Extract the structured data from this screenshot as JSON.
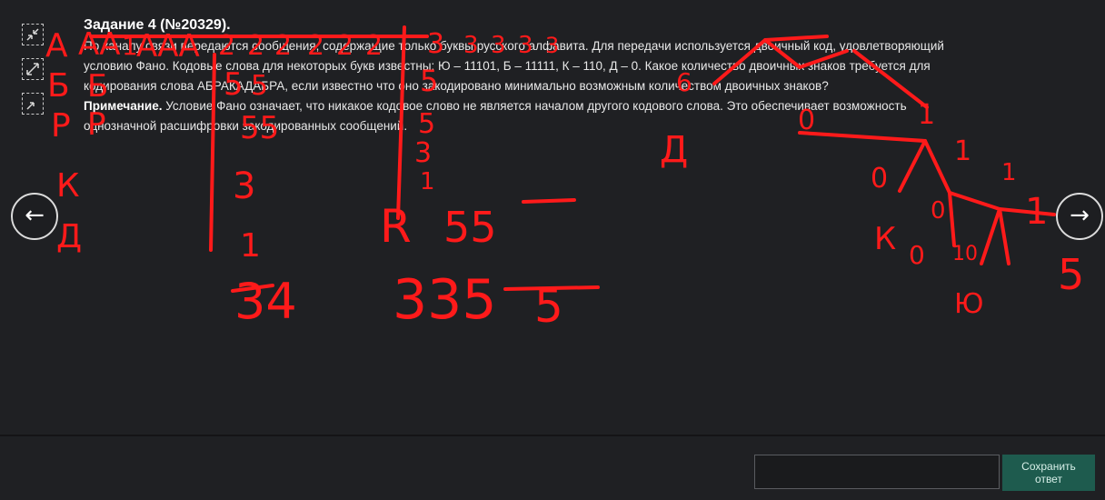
{
  "task": {
    "title": "Задание 4 (№20329).",
    "text_lines": [
      "По каналу связи передаются сообщения, содержащие только буквы русского алфавита. Для передачи используется двоичный код, удовлетворяющий",
      "условию Фано. Кодовые слова для некоторых букв известны: Ю – 11101, Б – 11111, К – 110, Д – 0. Какое количество двоичных знаков требуется для",
      "кодирования слова АБРАКАДАБРА, если известно что оно закодировано минимально возможным количеством двоичных знаков?"
    ],
    "note_label": "Примечание.",
    "note_text": " Условие Фано означает, что никакое кодовое слово не является началом другого кодового слова. Это обеспечивает возможность",
    "note_text2": "однозначной расшифровки закодированных сообщений."
  },
  "tools": [
    "collapse-icon",
    "expand-icon",
    "shrink-icon"
  ],
  "nav": {
    "prev": "←",
    "next": "→"
  },
  "answer": {
    "placeholder": "",
    "save_label": "Сохранить ответ"
  },
  "annotation_color": "#ff1a1a",
  "handwriting": {
    "left_col": [
      "А",
      "Б",
      "Р",
      "К",
      "Д"
    ],
    "top_seq": [
      "АА",
      "1",
      "ААА",
      "Д",
      "2",
      "2",
      "2",
      "2",
      "2",
      "2",
      "3",
      "3",
      "3",
      "3",
      "3"
    ],
    "col2": [
      "5",
      "5",
      "3",
      "1"
    ],
    "col3": [
      "5",
      "5",
      "3",
      "1"
    ],
    "mid": "R",
    "tree_labels": [
      "0",
      "1",
      "Д",
      "0",
      "1",
      "0",
      "1",
      "1",
      "0",
      "К",
      "10",
      "Ю",
      "1",
      "5",
      "6"
    ],
    "bottom_left": "34",
    "bottom_mid": "335",
    "bottom_mid2": "5",
    "five5": "55"
  }
}
